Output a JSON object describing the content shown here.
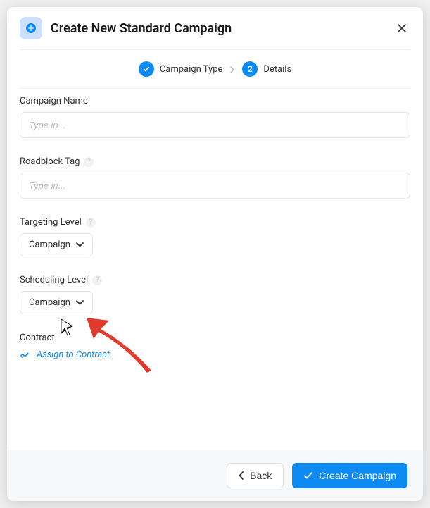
{
  "header": {
    "title": "Create New Standard Campaign"
  },
  "stepper": {
    "step1_label": "Campaign Type",
    "step2_label": "Details",
    "step2_number": "2"
  },
  "form": {
    "campaign_name": {
      "label": "Campaign Name",
      "placeholder": "Type in..."
    },
    "roadblock_tag": {
      "label": "Roadblock Tag",
      "placeholder": "Type in..."
    },
    "targeting_level": {
      "label": "Targeting Level",
      "value": "Campaign"
    },
    "scheduling_level": {
      "label": "Scheduling Level",
      "value": "Campaign"
    },
    "contract": {
      "label": "Contract",
      "assign_text": "Assign to Contract"
    }
  },
  "footer": {
    "back_label": "Back",
    "create_label": "Create Campaign"
  }
}
